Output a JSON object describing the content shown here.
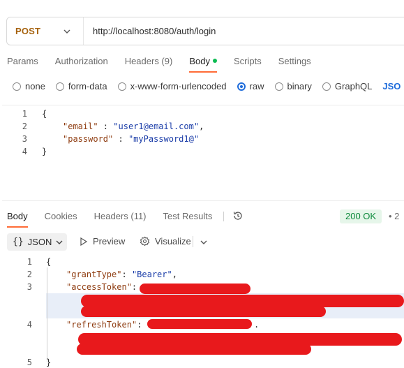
{
  "request": {
    "method": "POST",
    "url": "http://localhost:8080/auth/login",
    "tabs": [
      {
        "label": "Params",
        "active": false
      },
      {
        "label": "Authorization",
        "active": false
      },
      {
        "label": "Headers (9)",
        "active": false
      },
      {
        "label": "Body",
        "active": true
      },
      {
        "label": "Scripts",
        "active": false
      },
      {
        "label": "Settings",
        "active": false
      }
    ],
    "body_types": [
      {
        "label": "none",
        "selected": false
      },
      {
        "label": "form-data",
        "selected": false
      },
      {
        "label": "x-www-form-urlencoded",
        "selected": false
      },
      {
        "label": "raw",
        "selected": true
      },
      {
        "label": "binary",
        "selected": false
      },
      {
        "label": "GraphQL",
        "selected": false
      }
    ],
    "raw_format": "JSO",
    "body_lines": [
      {
        "num": "1",
        "text": "{"
      },
      {
        "num": "2",
        "key": "\"email\"",
        "sep": " : ",
        "value": "\"user1@email.com\"",
        "end": ","
      },
      {
        "num": "3",
        "key": "\"password\"",
        "sep": " : ",
        "value": "\"myPassword1@\"",
        "end": ""
      },
      {
        "num": "4",
        "text": "}"
      }
    ]
  },
  "response": {
    "tabs": [
      {
        "label": "Body",
        "active": true
      },
      {
        "label": "Cookies",
        "active": false
      },
      {
        "label": "Headers (11)",
        "active": false
      },
      {
        "label": "Test Results",
        "active": false
      }
    ],
    "status": "200 OK",
    "status_more": "• 2",
    "format_label": "JSON",
    "preview_label": "Preview",
    "visualize_label": "Visualize",
    "lines": [
      {
        "num": "1",
        "text": "{"
      },
      {
        "num": "2",
        "key": "\"grantType\"",
        "sep": ": ",
        "value": "\"Bearer\"",
        "end": ","
      },
      {
        "num": "3",
        "key": "\"accessToken\"",
        "sep": ": ",
        "value": "",
        "end": ""
      },
      {
        "num": "4",
        "key": "\"refreshToken\"",
        "sep": ": ",
        "value": "",
        "end": "."
      },
      {
        "num": "5",
        "text": "}"
      }
    ]
  },
  "colors": {
    "method": "#a6620d",
    "active_underline": "#ff6c37",
    "status_green": "#0c8a3b",
    "redaction": "#e8191c",
    "json_key": "#8e3b0f",
    "json_string": "#1a3ca8"
  }
}
